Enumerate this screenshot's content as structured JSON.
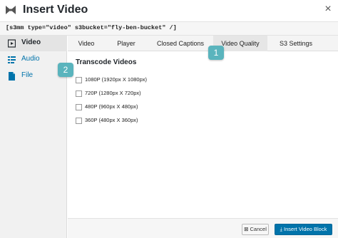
{
  "window": {
    "title": "Insert Video",
    "close_glyph": "×",
    "logo_icon": "bowtie-logo-icon"
  },
  "shortcode": "[s3mm type=\"video\" s3bucket=\"fly-ben-bucket\" /]",
  "sidebar": {
    "items": [
      {
        "label": "Video",
        "icon": "video-icon",
        "active": true
      },
      {
        "label": "Audio",
        "icon": "audio-icon",
        "active": false
      },
      {
        "label": "File",
        "icon": "file-icon",
        "active": false
      }
    ]
  },
  "tabs": [
    {
      "label": "Video",
      "active": false
    },
    {
      "label": "Player",
      "active": false
    },
    {
      "label": "Closed Captions",
      "active": false
    },
    {
      "label": "Video Quality",
      "active": true
    },
    {
      "label": "S3 Settings",
      "active": false
    }
  ],
  "panel": {
    "section_title": "Transcode Videos",
    "options": [
      {
        "label": "1080P (1920px X 1080px)",
        "checked": false
      },
      {
        "label": "720P (1280px X 720px)",
        "checked": false
      },
      {
        "label": "480P (960px X 480px)",
        "checked": false
      },
      {
        "label": "360P (480px X 360px)",
        "checked": false
      }
    ]
  },
  "annotations": {
    "badge_1": "1",
    "badge_2": "2"
  },
  "footer": {
    "cancel_label": "Cancel",
    "insert_label": "Insert Video Block"
  },
  "colors": {
    "accent": "#0073aa",
    "badge": "#5ab4bd"
  }
}
